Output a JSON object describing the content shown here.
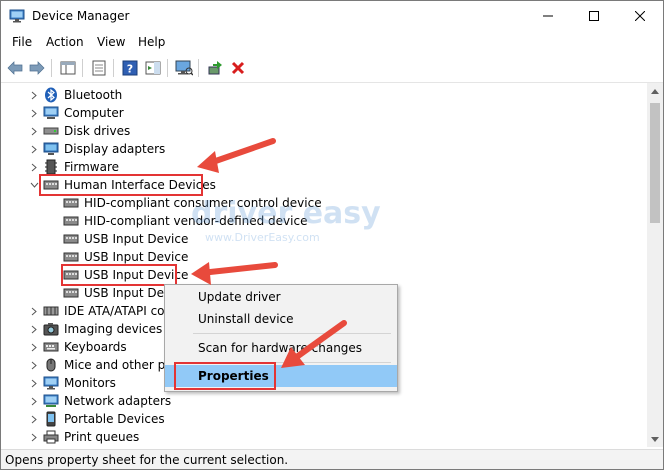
{
  "window": {
    "title": "Device Manager"
  },
  "menu": {
    "items": [
      "File",
      "Action",
      "View",
      "Help"
    ]
  },
  "tree": {
    "items": [
      {
        "label": "Bluetooth",
        "icon": "bluetooth-icon"
      },
      {
        "label": "Computer",
        "icon": "computer-icon"
      },
      {
        "label": "Disk drives",
        "icon": "disk-drive-icon"
      },
      {
        "label": "Display adapters",
        "icon": "display-adapter-icon"
      },
      {
        "label": "Firmware",
        "icon": "firmware-icon"
      },
      {
        "label": "Human Interface Devices",
        "icon": "hid-icon"
      },
      {
        "label": "HID-compliant consumer control device",
        "icon": "hid-icon"
      },
      {
        "label": "HID-compliant vendor-defined device",
        "icon": "hid-icon"
      },
      {
        "label": "USB Input Device",
        "icon": "hid-icon"
      },
      {
        "label": "USB Input Device",
        "icon": "hid-icon"
      },
      {
        "label": "USB Input Device",
        "icon": "hid-icon"
      },
      {
        "label": "USB Input Devi",
        "icon": "hid-icon"
      },
      {
        "label": "IDE ATA/ATAPI co",
        "icon": "ide-icon"
      },
      {
        "label": "Imaging devices",
        "icon": "camera-icon"
      },
      {
        "label": "Keyboards",
        "icon": "keyboard-icon"
      },
      {
        "label": "Mice and other po",
        "icon": "mouse-icon"
      },
      {
        "label": "Monitors",
        "icon": "monitor-icon"
      },
      {
        "label": "Network adapters",
        "icon": "network-icon"
      },
      {
        "label": "Portable Devices",
        "icon": "portable-device-icon"
      },
      {
        "label": "Print queues",
        "icon": "printer-icon"
      }
    ]
  },
  "context_menu": {
    "items": [
      "Update driver",
      "Uninstall device",
      "Scan for hardware changes",
      "Properties"
    ]
  },
  "watermark": {
    "main": "driver easy",
    "sub": "www.DriverEasy.com"
  },
  "status": {
    "text": "Opens property sheet for the current selection."
  },
  "colors": {
    "highlight_box": "#e33434",
    "selection": "#91c9f7",
    "arrow": "#e84a3c"
  }
}
